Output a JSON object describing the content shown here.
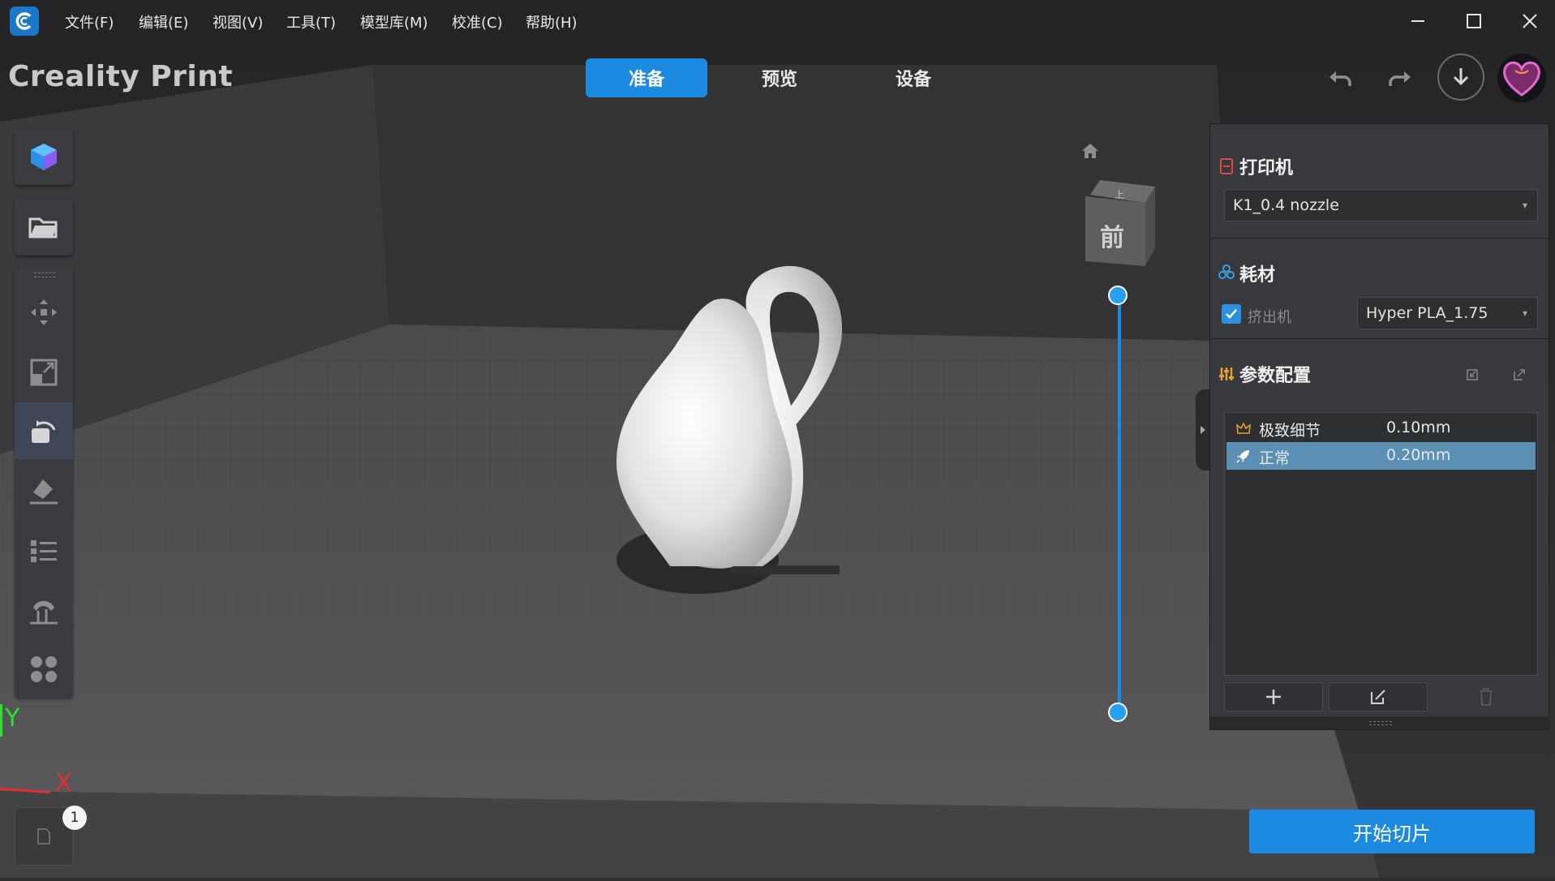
{
  "menubar": {
    "items": [
      {
        "label": "文件(F)"
      },
      {
        "label": "编辑(E)"
      },
      {
        "label": "视图(V)"
      },
      {
        "label": "工具(T)"
      },
      {
        "label": "模型库(M)"
      },
      {
        "label": "校准(C)"
      },
      {
        "label": "帮助(H)"
      }
    ]
  },
  "header": {
    "app_title": "Creality Print",
    "tabs": [
      {
        "label": "准备",
        "active": true
      },
      {
        "label": "预览",
        "active": false
      },
      {
        "label": "设备",
        "active": false
      }
    ]
  },
  "viewport": {
    "view_cube_label": "前",
    "axis_x": "X",
    "axis_y": "Y",
    "plate_number": "1"
  },
  "right_panel": {
    "printer": {
      "title": "打印机",
      "selected": "K1_0.4 nozzle"
    },
    "filament": {
      "title": "耗材",
      "extruder_label": "挤出机",
      "extruder_checked": true,
      "selected": "Hyper PLA_1.75"
    },
    "params": {
      "title": "参数配置",
      "profiles": [
        {
          "name": "极致细节",
          "value": "0.10mm",
          "icon": "crown-icon",
          "selected": false
        },
        {
          "name": "正常",
          "value": "0.20mm",
          "icon": "rocket-icon",
          "selected": true
        }
      ]
    }
  },
  "slice_button": {
    "label": "开始切片"
  },
  "colors": {
    "accent": "#1d8ae2",
    "selected_row": "#5b8fb4",
    "panel_bg": "#38393c",
    "printer_icon": "#e04848",
    "filament_icon": "#3b9be8",
    "params_icon": "#e8a12b"
  }
}
